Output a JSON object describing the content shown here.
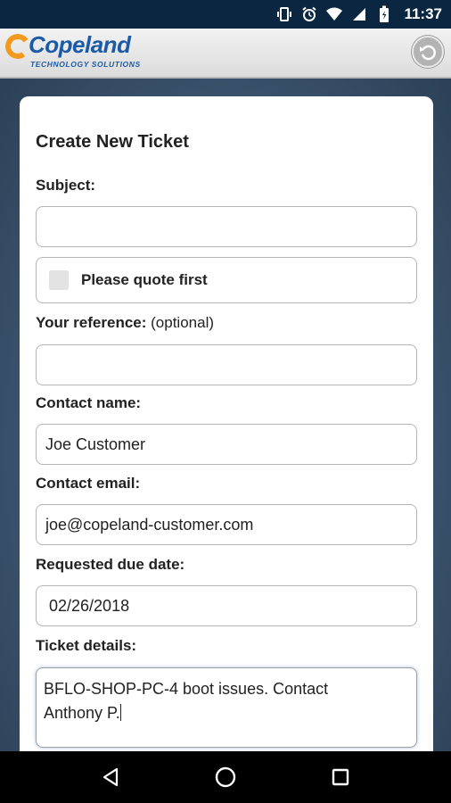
{
  "status_bar": {
    "time": "11:37",
    "icons": [
      "vibrate-icon",
      "alarm-icon",
      "wifi-icon",
      "signal-icon",
      "battery-icon"
    ]
  },
  "header": {
    "logo_name": "Copeland",
    "logo_subtitle": "TECHNOLOGY SOLUTIONS",
    "back_icon": "back-circle-icon",
    "brand_color": "#1c5aa8",
    "accent_color": "#f39a1e"
  },
  "form": {
    "title": "Create New Ticket",
    "subject": {
      "label": "Subject:",
      "value": ""
    },
    "quote_checkbox": {
      "label": "Please quote first",
      "checked": false
    },
    "reference": {
      "label": "Your reference:",
      "optional_note": "(optional)",
      "value": ""
    },
    "contact_name": {
      "label": "Contact name:",
      "value": "Joe Customer"
    },
    "contact_email": {
      "label": "Contact email:",
      "value": "joe@copeland-customer.com"
    },
    "due_date": {
      "label": "Requested due date:",
      "value": "02/26/2018"
    },
    "details": {
      "label": "Ticket details:",
      "line1": "BFLO-SHOP-PC-4 boot issues. Contact",
      "line2": "Anthony P."
    }
  },
  "nav_bar": {
    "icons": [
      "back-triangle-icon",
      "home-circle-icon",
      "recents-square-icon"
    ]
  }
}
